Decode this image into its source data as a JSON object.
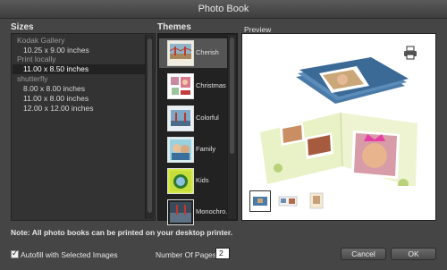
{
  "window": {
    "title": "Photo Book"
  },
  "sections": {
    "sizes": "Sizes",
    "themes": "Themes",
    "preview": "Preview"
  },
  "sizes": {
    "rows": [
      {
        "type": "group",
        "label": "Kodak Gallery"
      },
      {
        "type": "item",
        "label": "10.25 x 9.00 inches"
      },
      {
        "type": "group",
        "label": "Print locally"
      },
      {
        "type": "item",
        "label": "11.00 x 8.50 inches",
        "selected": true
      },
      {
        "type": "group",
        "label": "shutterfly"
      },
      {
        "type": "item",
        "label": "8.00 x 8.00 inches"
      },
      {
        "type": "item",
        "label": "11.00 x 8.00 inches"
      },
      {
        "type": "item",
        "label": "12.00 x 12.00 inches"
      }
    ]
  },
  "themes": {
    "items": [
      {
        "label": "Cherish",
        "icon": "bridge-photo-thumb",
        "selected": true
      },
      {
        "label": "Christmas",
        "icon": "christmas-photo-thumb"
      },
      {
        "label": "Colorful",
        "icon": "bridge-blue-thumb"
      },
      {
        "label": "Family",
        "icon": "family-photo-thumb"
      },
      {
        "label": "Kids",
        "icon": "kids-photo-thumb"
      },
      {
        "label": "Monochro...",
        "icon": "monochrome-thumb"
      }
    ]
  },
  "preview": {
    "printer_icon": "printer-icon",
    "thumbnails": [
      "cover-preview",
      "spread-preview",
      "page-preview"
    ],
    "selected_thumbnail": 0
  },
  "note": "Note: All photo books can be printed on your desktop printer.",
  "autofill": {
    "label": "Autofill with Selected Images",
    "checked": true
  },
  "pages": {
    "label": "Number Of Pages:",
    "value": "2"
  },
  "buttons": {
    "cancel": "Cancel",
    "ok": "OK"
  },
  "colors": {
    "window_bg": "#454545",
    "list_bg": "#333333",
    "themes_bg": "#222222",
    "selection": "#555555"
  }
}
